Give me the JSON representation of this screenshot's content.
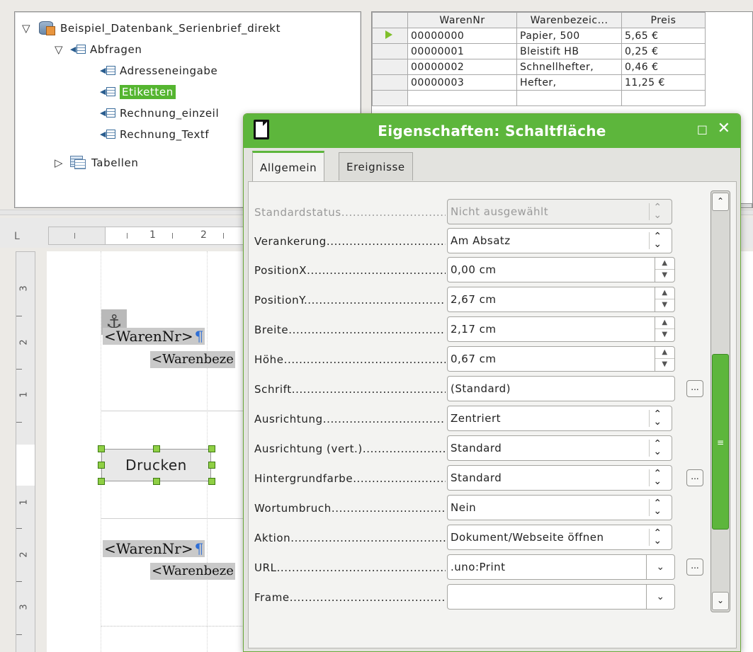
{
  "tree": {
    "root": "Beispiel_Datenbank_Serienbrief_direkt",
    "queries_folder": "Abfragen",
    "queries": [
      "Adresseneingabe",
      "Etiketten",
      "Rechnung_einzeil",
      "Rechnung_Textf"
    ],
    "selected_query": "Etiketten",
    "tables_folder": "Tabellen"
  },
  "grid": {
    "headers": [
      "WarenNr",
      "Warenbezeic...",
      "Preis"
    ],
    "rows": [
      [
        "00000000",
        "Papier, 500",
        "5,65 €"
      ],
      [
        "00000001",
        "Bleistift HB",
        "0,25 €"
      ],
      [
        "00000002",
        "Schnellhefter,",
        "0,46 €"
      ],
      [
        "00000003",
        "Hefter,",
        "11,25 €"
      ]
    ]
  },
  "ruler": {
    "corner": "L",
    "h_numbers": [
      "1",
      "2"
    ],
    "v_numbers": [
      "3",
      "2",
      "1",
      "1",
      "2",
      "3"
    ]
  },
  "document": {
    "field_warennr": "<WarenNr>",
    "field_warenbez": "<Warenbeze",
    "pilcrow": "¶",
    "button_label": "Drucken",
    "anchor_glyph": "⚓"
  },
  "dialog": {
    "title": "Eigenschaften: Schaltfläche",
    "tabs": [
      "Allgemein",
      "Ereignisse"
    ],
    "active_tab": "Allgemein",
    "properties": [
      {
        "label": "Standardstatus",
        "value": "Nicht ausgewählt"
      },
      {
        "label": "Verankerung",
        "value": "Am Absatz"
      },
      {
        "label": "PositionX",
        "value": "0,00 cm"
      },
      {
        "label": "PositionY",
        "value": "2,67 cm"
      },
      {
        "label": "Breite",
        "value": "2,17 cm"
      },
      {
        "label": "Höhe",
        "value": "0,67 cm"
      },
      {
        "label": "Schrift",
        "value": "(Standard)"
      },
      {
        "label": "Ausrichtung",
        "value": "Zentriert"
      },
      {
        "label": "Ausrichtung (vert.)",
        "value": "Standard"
      },
      {
        "label": "Hintergrundfarbe",
        "value": "Standard"
      },
      {
        "label": "Wortumbruch",
        "value": "Nein"
      },
      {
        "label": "Aktion",
        "value": "Dokument/Webseite öffnen"
      },
      {
        "label": "URL",
        "value": ".uno:Print"
      },
      {
        "label": "Frame",
        "value": ""
      }
    ],
    "dots_button": "...",
    "max_icon": "□",
    "close_icon": "✕"
  },
  "colors": {
    "accent_green": "#5db63c",
    "selection_green": "#55b530",
    "field_grey": "#c9c9c9",
    "pilcrow_blue": "#2f6fd6"
  }
}
